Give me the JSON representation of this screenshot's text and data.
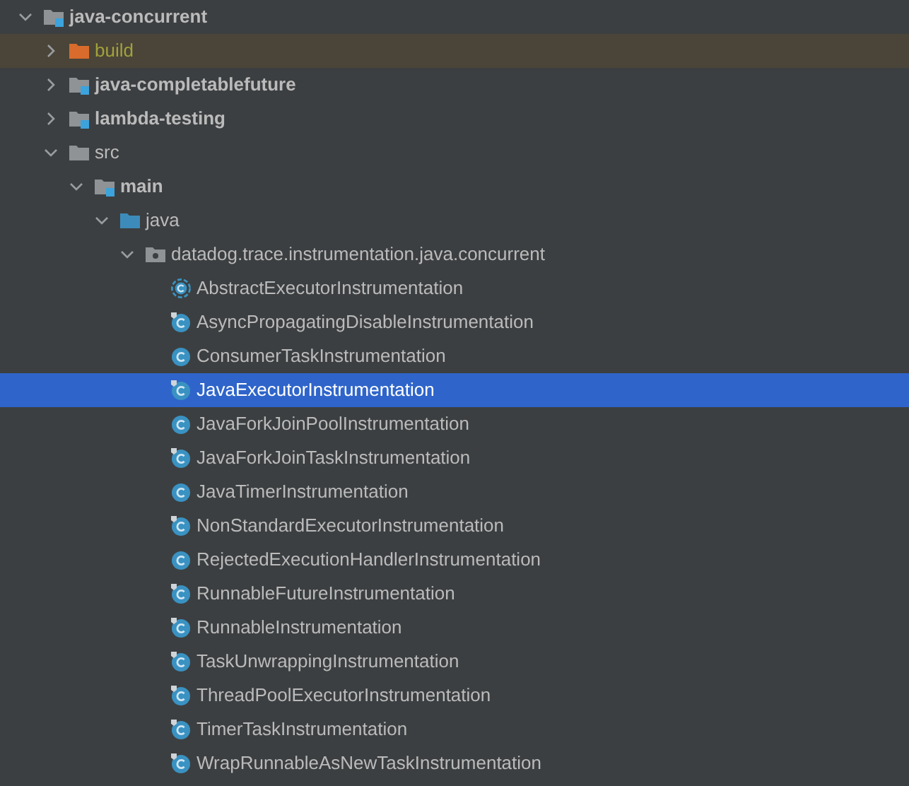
{
  "project_tree": [
    {
      "label": "java-concurrent",
      "kind": "module",
      "expanded": true,
      "selected": false,
      "children": [
        {
          "label": "build",
          "kind": "excluded-folder",
          "expanded": false,
          "selected": false
        },
        {
          "label": "java-completablefuture",
          "kind": "module",
          "expanded": false,
          "selected": false
        },
        {
          "label": "lambda-testing",
          "kind": "module",
          "expanded": false,
          "selected": false
        },
        {
          "label": "src",
          "kind": "folder",
          "expanded": true,
          "selected": false,
          "children": [
            {
              "label": "main",
              "kind": "module",
              "expanded": true,
              "selected": false,
              "children": [
                {
                  "label": "java",
                  "kind": "source-root",
                  "expanded": true,
                  "selected": false,
                  "children": [
                    {
                      "label": "datadog.trace.instrumentation.java.concurrent",
                      "kind": "package",
                      "expanded": true,
                      "selected": false,
                      "children": [
                        {
                          "label": "AbstractExecutorInstrumentation",
                          "kind": "abstract-class",
                          "marked": false,
                          "selected": false
                        },
                        {
                          "label": "AsyncPropagatingDisableInstrumentation",
                          "kind": "class",
                          "marked": true,
                          "selected": false
                        },
                        {
                          "label": "ConsumerTaskInstrumentation",
                          "kind": "class",
                          "marked": false,
                          "selected": false
                        },
                        {
                          "label": "JavaExecutorInstrumentation",
                          "kind": "class",
                          "marked": true,
                          "selected": true
                        },
                        {
                          "label": "JavaForkJoinPoolInstrumentation",
                          "kind": "class",
                          "marked": false,
                          "selected": false
                        },
                        {
                          "label": "JavaForkJoinTaskInstrumentation",
                          "kind": "class",
                          "marked": true,
                          "selected": false
                        },
                        {
                          "label": "JavaTimerInstrumentation",
                          "kind": "class",
                          "marked": false,
                          "selected": false
                        },
                        {
                          "label": "NonStandardExecutorInstrumentation",
                          "kind": "class",
                          "marked": true,
                          "selected": false
                        },
                        {
                          "label": "RejectedExecutionHandlerInstrumentation",
                          "kind": "class",
                          "marked": false,
                          "selected": false
                        },
                        {
                          "label": "RunnableFutureInstrumentation",
                          "kind": "class",
                          "marked": true,
                          "selected": false
                        },
                        {
                          "label": "RunnableInstrumentation",
                          "kind": "class",
                          "marked": true,
                          "selected": false
                        },
                        {
                          "label": "TaskUnwrappingInstrumentation",
                          "kind": "class",
                          "marked": true,
                          "selected": false
                        },
                        {
                          "label": "ThreadPoolExecutorInstrumentation",
                          "kind": "class",
                          "marked": true,
                          "selected": false
                        },
                        {
                          "label": "TimerTaskInstrumentation",
                          "kind": "class",
                          "marked": true,
                          "selected": false
                        },
                        {
                          "label": "WrapRunnableAsNewTaskInstrumentation",
                          "kind": "class",
                          "marked": true,
                          "selected": false
                        }
                      ]
                    }
                  ]
                }
              ]
            }
          ]
        }
      ]
    }
  ]
}
